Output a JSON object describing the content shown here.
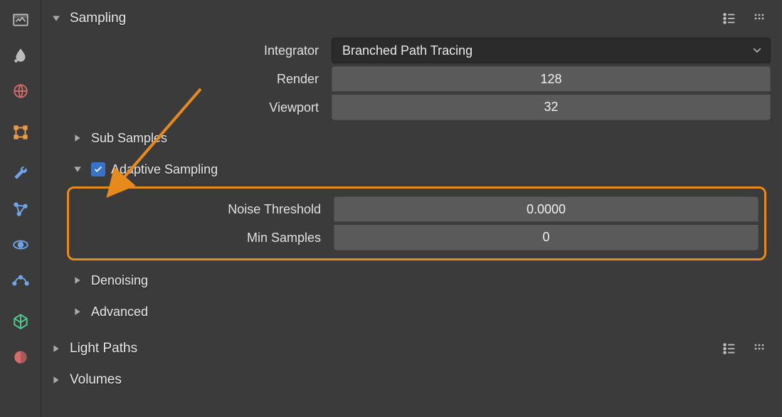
{
  "accent": "#e68a1e",
  "sidebar": {
    "items": [
      {
        "name": "output-tab",
        "color": "#bdbdbd"
      },
      {
        "name": "water-tab",
        "color": "#bdbdbd"
      },
      {
        "name": "world-tab",
        "color": "#d06a6a"
      },
      {
        "name": "object-tab",
        "color": "#e69b4b"
      },
      {
        "name": "wrench-tab",
        "color": "#6fa4e6"
      },
      {
        "name": "graph-tab",
        "color": "#6fa4e6"
      },
      {
        "name": "orbit-tab",
        "color": "#6fa4e6"
      },
      {
        "name": "trajectory-tab",
        "color": "#6fa4e6"
      },
      {
        "name": "mesh-tab",
        "color": "#52c98e"
      },
      {
        "name": "material-tab",
        "color": "#d96b6b"
      }
    ]
  },
  "panels": {
    "sampling": {
      "title": "Sampling",
      "integrator_label": "Integrator",
      "integrator_value": "Branched Path Tracing",
      "render_label": "Render",
      "render_value": "128",
      "viewport_label": "Viewport",
      "viewport_value": "32",
      "sub": {
        "subsamples": "Sub Samples",
        "adaptive": {
          "label": "Adaptive Sampling",
          "checked": true,
          "noise_label": "Noise Threshold",
          "noise_value": "0.0000",
          "min_label": "Min Samples",
          "min_value": "0"
        },
        "denoising": "Denoising",
        "advanced": "Advanced"
      }
    },
    "light_paths": {
      "title": "Light Paths"
    },
    "volumes": {
      "title": "Volumes"
    }
  },
  "icons": {
    "list": "list-icon",
    "drag": "drag-handle-icon"
  }
}
